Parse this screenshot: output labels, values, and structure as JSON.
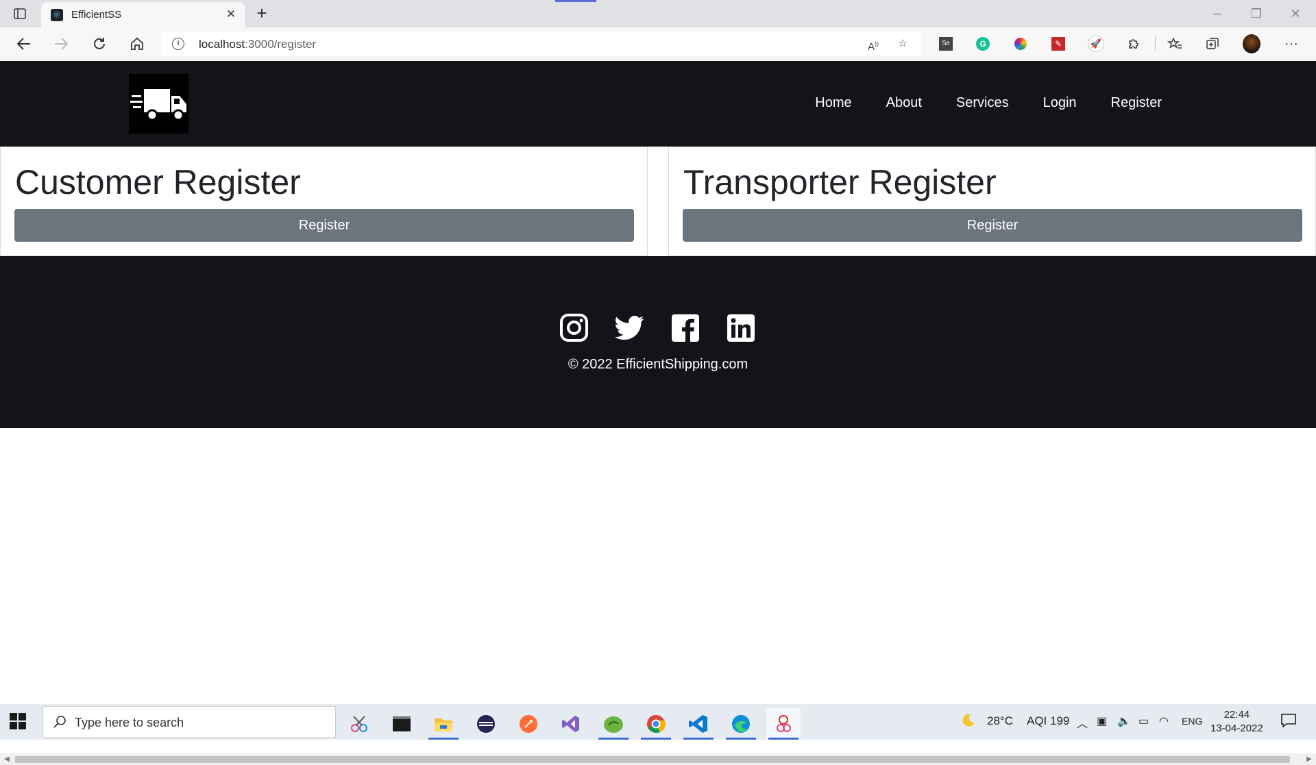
{
  "browser": {
    "tab_title": "EfficientSS",
    "tab_close": "✕",
    "new_tab": "+",
    "url_host": "localhost",
    "url_path": ":3000/register"
  },
  "site": {
    "nav": [
      "Home",
      "About",
      "Services",
      "Login",
      "Register"
    ],
    "cards": [
      {
        "title": "Customer Register",
        "button": "Register"
      },
      {
        "title": "Transporter Register",
        "button": "Register"
      }
    ],
    "footer": {
      "social_icons": [
        "instagram-icon",
        "twitter-icon",
        "facebook-icon",
        "linkedin-icon"
      ],
      "copyright": "© 2022 EfficientShipping.com"
    },
    "colors": {
      "dark": "#121419",
      "button": "#6c757d"
    }
  },
  "taskbar": {
    "search_placeholder": "Type here to search",
    "weather_temp": "28°C",
    "aqi": "AQI 199",
    "language": "ENG",
    "time": "22:44",
    "date": "13-04-2022"
  }
}
